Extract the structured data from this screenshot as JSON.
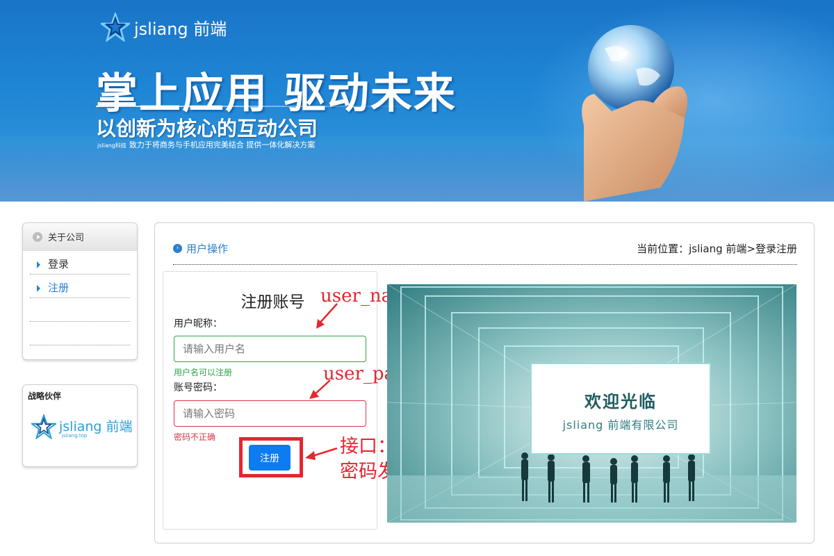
{
  "banner": {
    "logo_text": "jsliang 前端",
    "slogan_main": "掌上应用  驱动未来",
    "slogan_sub": "以创新为核心的互动公司",
    "slogan_small_brand": "jsliang科技",
    "slogan_small": "致力于将商务与手机应用完美结合  提供一体化解决方案"
  },
  "sidebar": {
    "about_title": "关于公司",
    "items": [
      {
        "label": "登录",
        "active": false
      },
      {
        "label": "注册",
        "active": true
      }
    ],
    "partner_title": "战略伙伴",
    "partner_logo_text": "jsliang 前端",
    "partner_logo_sub": "jsliang.top"
  },
  "main": {
    "section_title": "用户操作",
    "breadcrumb": "当前位置：jsliang 前端>登录注册",
    "form": {
      "title": "注册账号",
      "name_label": "用户昵称：",
      "name_placeholder": "请输入用户名",
      "name_hint": "用户名可以注册",
      "pass_label": "账号密码：",
      "pass_placeholder": "请输入密码",
      "pass_hint": "密码不正确",
      "submit_label": "注册"
    },
    "annotations": {
      "user_name": "user_name",
      "user_password": "user_password",
      "api": "接口：将用户名和密码发给后端"
    },
    "welcome": {
      "title": "欢迎光临",
      "subtitle": "jsliang 前端有限公司"
    }
  },
  "colors": {
    "accent": "#2b7fd0",
    "success": "#28a745",
    "danger": "#dc3545",
    "annotation": "#e3272f",
    "button": "#0d7cf0"
  }
}
